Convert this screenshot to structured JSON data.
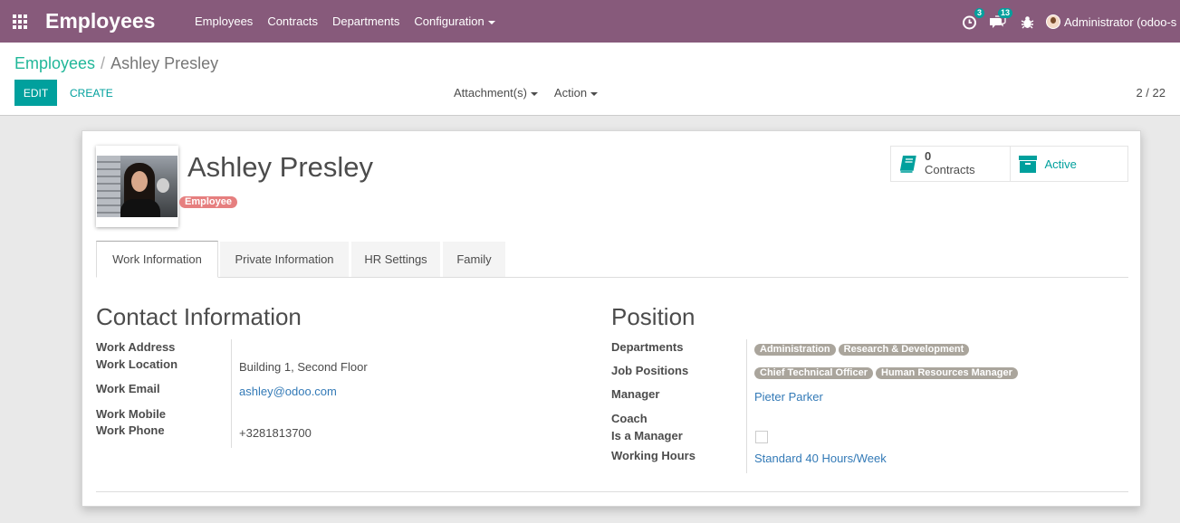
{
  "app": {
    "brand": "Employees",
    "menu": [
      "Employees",
      "Contracts",
      "Departments",
      "Configuration"
    ],
    "systray": {
      "activity_count": "3",
      "messages_count": "13",
      "user": "Administrator (odoo-s"
    }
  },
  "control_panel": {
    "breadcrumb_parent": "Employees",
    "breadcrumb_sep": "/",
    "breadcrumb_current": "Ashley Presley",
    "edit_label": "EDIT",
    "create_label": "CREATE",
    "attachments_label": "Attachment(s)",
    "action_label": "Action",
    "pager": "2 / 22"
  },
  "employee": {
    "name": "Ashley Presley",
    "tag": "Employee"
  },
  "smart_buttons": {
    "contracts_count": "0",
    "contracts_label": "Contracts",
    "active_label": "Active"
  },
  "tabs": [
    "Work Information",
    "Private Information",
    "HR Settings",
    "Family"
  ],
  "contact": {
    "title": "Contact Information",
    "work_address_label": "Work Address",
    "work_location_label": "Work Location",
    "work_location": "Building 1, Second Floor",
    "work_email_label": "Work Email",
    "work_email": "ashley@odoo.com",
    "work_mobile_label": "Work Mobile",
    "work_phone_label": "Work Phone",
    "work_phone": "+3281813700"
  },
  "position": {
    "title": "Position",
    "departments_label": "Departments",
    "departments": [
      "Administration",
      "Research & Development"
    ],
    "job_positions_label": "Job Positions",
    "job_positions": [
      "Chief Technical Officer",
      "Human Resources Manager"
    ],
    "manager_label": "Manager",
    "manager": "Pieter Parker",
    "coach_label": "Coach",
    "is_manager_label": "Is a Manager",
    "working_hours_label": "Working Hours",
    "working_hours": "Standard 40 Hours/Week"
  },
  "colors": {
    "navbar": "#875a7b",
    "primary": "#00a09d",
    "breadcrumb_link": "#21b799",
    "link": "#337ab7",
    "employee_tag": "#e67f7f",
    "pill": "#aaa59c"
  }
}
